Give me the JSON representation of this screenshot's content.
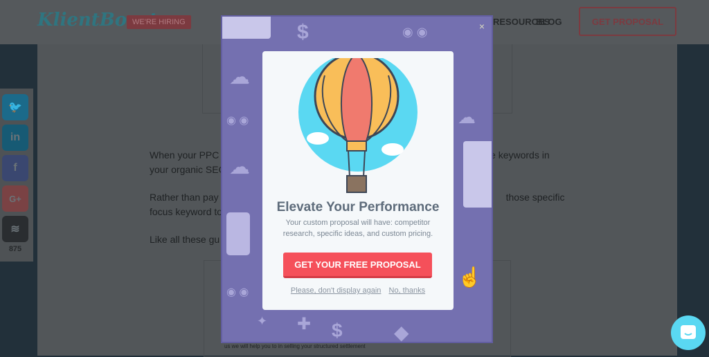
{
  "header": {
    "logo": "KlientBoost",
    "hiring": "WE'RE HIRING",
    "nav": [
      "RESOURCES",
      "BLOG"
    ],
    "cta": "GET PROPOSAL"
  },
  "article": {
    "p1a": "When your PPC",
    "p1b": "me keywords in",
    "p1c": "your organic SEO",
    "p2a": "Rather than pay",
    "p2b": "those specific",
    "p2c": "focus keyword to",
    "p3": "Like all these gu",
    "caption": "us we will help you to in selling your structured settlement"
  },
  "share": {
    "buttons": [
      "twitter",
      "linkedin",
      "facebook",
      "google-plus",
      "buffer"
    ],
    "count": "875"
  },
  "popup": {
    "title": "Elevate Your Performance",
    "subtitle": "Your custom proposal will have: competitor research, specific ideas, and custom pricing.",
    "cta": "GET YOUR FREE PROPOSAL",
    "dont_display": "Please, don't display again",
    "no_thanks": "No, thanks",
    "close": "×"
  },
  "colors": {
    "popup_bg": "#7470b0",
    "cta": "#f5505a",
    "chat": "#5ad8f2"
  }
}
